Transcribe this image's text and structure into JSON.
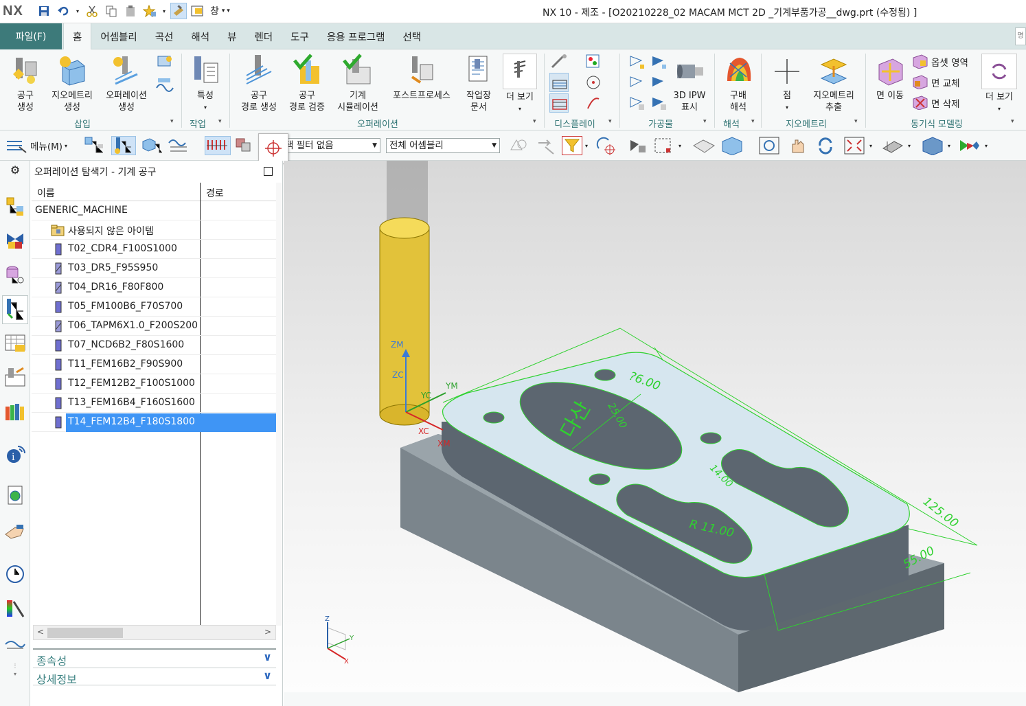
{
  "app": {
    "logo": "NX",
    "title": "NX 10 - 제조 - [O20210228_02 MACAM MCT 2D _기계부품가공__dwg.prt (수정됨) ]",
    "window_menu": "창"
  },
  "menubar": {
    "file_tab": "파일(F)",
    "tabs": [
      "홈",
      "어셈블리",
      "곡선",
      "해석",
      "뷰",
      "렌더",
      "도구",
      "응용 프로그램",
      "선택"
    ],
    "active_tab": "홈"
  },
  "ribbon": {
    "buttons": {
      "create_tool": [
        "공구",
        "생성"
      ],
      "create_geometry": [
        "지오메트리",
        "생성"
      ],
      "create_operation": [
        "오퍼레이션",
        "생성"
      ],
      "feature": [
        "특성"
      ],
      "generate_toolpath": [
        "공구",
        "경로 생성"
      ],
      "verify_toolpath": [
        "공구",
        "경로 검증"
      ],
      "machine_simulation": [
        "기계",
        "시뮬레이션"
      ],
      "postprocess": [
        "포스트프로세스"
      ],
      "shop_doc": [
        "작업장",
        "문서"
      ],
      "more1": [
        "더 보기"
      ],
      "ipw_display": [
        "3D IPW",
        "표시"
      ],
      "gradient_analysis": [
        "구배",
        "해석"
      ],
      "point": [
        "점"
      ],
      "extract_geometry": [
        "지오메트리",
        "추출"
      ],
      "move_face": [
        "면 이동"
      ],
      "offset_region": "옵셋 영역",
      "replace_face": "면 교체",
      "delete_face": "면 삭제",
      "more2": [
        "더 보기"
      ]
    },
    "groups": [
      "삽입",
      "작업",
      "오퍼레이션",
      "디스플레이",
      "가공물",
      "해석",
      "지오메트리",
      "동기식 모델링"
    ]
  },
  "toolbar2": {
    "menu_label": "메뉴(M)",
    "filter_combo": "택 필터 없음",
    "assembly_combo": "전체 어셈블리"
  },
  "navigator": {
    "title": "오퍼레이션 탐색기 - 기계 공구",
    "col_name": "이름",
    "col_path": "경로",
    "root": "GENERIC_MACHINE",
    "unused": "사용되지 않은 아이템",
    "tools": [
      "T02_CDR4_F100S1000",
      "T03_DR5_F95S950",
      "T04_DR16_F80F800",
      "T05_FM100B6_F70S700",
      "T06_TAPM6X1.0_F200S200",
      "T07_NCD6B2_F80S1600",
      "T11_FEM16B2_F90S900",
      "T12_FEM12B2_F100S1000",
      "T13_FEM16B4_F160S1600",
      "T14_FEM12B4_F180S1800"
    ],
    "selected_tool": "T14_FEM12B4_F180S1800",
    "panel_dependencies": "종속성",
    "panel_details": "상세정보"
  },
  "viewport": {
    "axis_labels": {
      "zm": "ZM",
      "zc": "ZC",
      "ym": "YM",
      "yc": "YC",
      "xc": "XC",
      "xm": "XM"
    },
    "dimensions": {
      "d1": "?6.00",
      "d2": "125.00",
      "d3": "55.00",
      "r1": "R 11.00",
      "d4": "14.00",
      "d5": "25.00"
    },
    "engraving": "다산",
    "triad": {
      "x": "X",
      "y": "Y",
      "z": "Z"
    },
    "colors": {
      "tool": "#e2c23a",
      "part_top": "#d6e6ef",
      "part_side": "#5c6670",
      "stock": "#7b858c",
      "dim": "#2fd12f"
    }
  }
}
